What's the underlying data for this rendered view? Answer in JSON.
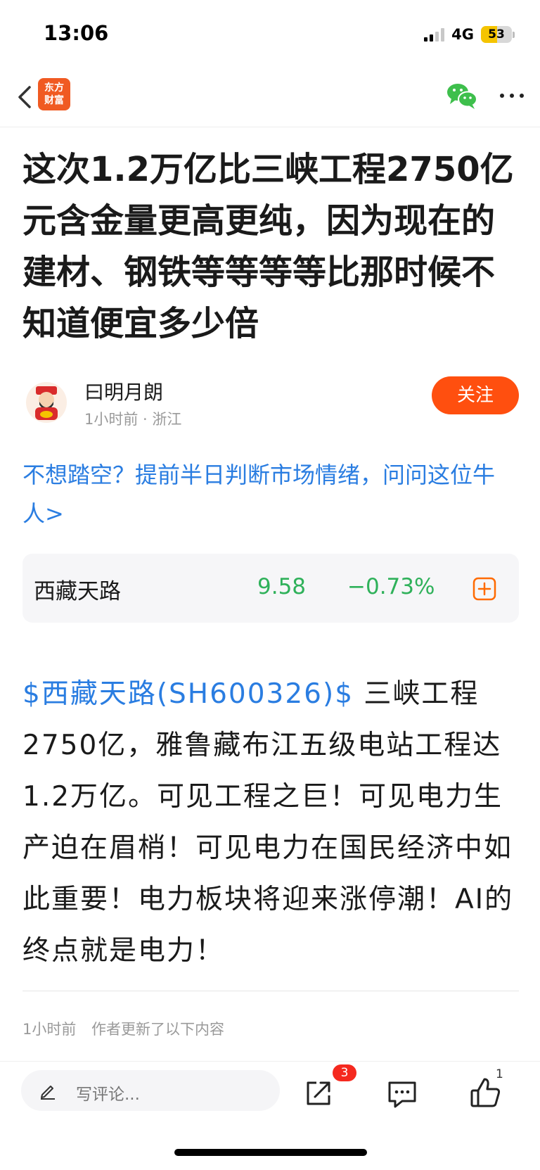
{
  "status_bar": {
    "time": "13:06",
    "network": "4G",
    "battery": "53",
    "battery_level": 0.53
  },
  "nav": {
    "logo_line1": "东方",
    "logo_line2": "财富"
  },
  "article": {
    "title": "这次1.2万亿比三峡工程2750亿元含金量更高更纯，因为现在的建材、钢铁等等等等比那时候不知道便宜多少倍",
    "author": {
      "name": "曰明月朗",
      "meta": "1小时前 · 浙江",
      "follow_label": "关注"
    },
    "promo": "不想踏空？提前半日判断市场情绪，问问这位牛人>",
    "stock": {
      "name": "西藏天路",
      "price": "9.58",
      "change": "−0.73%"
    },
    "body_link": "$西藏天路(SH600326)$",
    "body": "  三峡工程2750亿，雅鲁藏布江五级电站工程达1.2万亿。可见工程之巨！可见电力生产迫在眉梢！可见电力在国民经济中如此重要！电力板块将迎来涨停潮！AI的终点就是电力！",
    "update_time": "1小时前",
    "update_note": "作者更新了以下内容"
  },
  "bottom_bar": {
    "comment_placeholder": "写评论...",
    "share_badge": "3",
    "like_count": "1"
  },
  "colors": {
    "accent": "#ff4f0f",
    "link": "#2a7de1",
    "down": "#2fb15a",
    "badge": "#f5291f"
  }
}
